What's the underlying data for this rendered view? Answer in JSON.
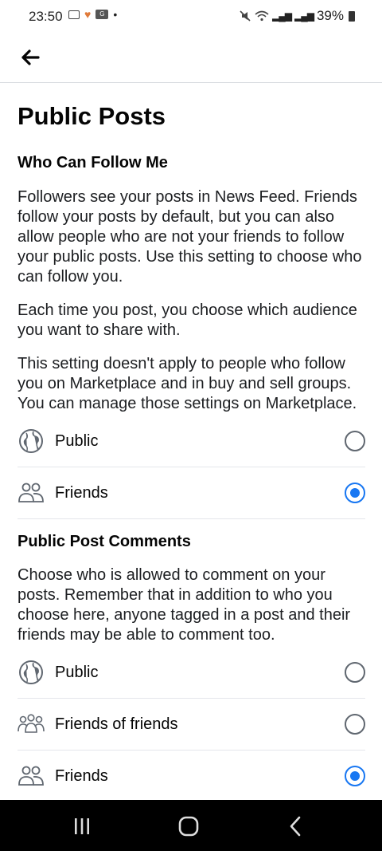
{
  "status_bar": {
    "time": "23:50",
    "battery": "39%"
  },
  "page": {
    "title": "Public Posts"
  },
  "follow_section": {
    "title": "Who Can Follow Me",
    "paragraphs": [
      "Followers see your posts in News Feed. Friends follow your posts by default, but you can also allow people who are not your friends to follow your public posts. Use this setting to choose who can follow you.",
      "Each time you post, you choose which audience you want to share with.",
      "This setting doesn't apply to people who follow you on Marketplace and in buy and sell groups. You can manage those settings on Marketplace."
    ],
    "options": [
      {
        "label": "Public",
        "icon": "globe-icon",
        "selected": false
      },
      {
        "label": "Friends",
        "icon": "friends-icon",
        "selected": true
      }
    ]
  },
  "comments_section": {
    "title": "Public Post Comments",
    "paragraph": "Choose who is allowed to comment on your posts. Remember that in addition to who you choose here, anyone tagged in a post and their friends may be able to comment too.",
    "options": [
      {
        "label": "Public",
        "icon": "globe-icon",
        "selected": false
      },
      {
        "label": "Friends of friends",
        "icon": "friends-of-friends-icon",
        "selected": false
      },
      {
        "label": "Friends",
        "icon": "friends-icon",
        "selected": true
      }
    ]
  },
  "colors": {
    "accent": "#1877f2",
    "text": "#050505",
    "divider": "#e4e6eb"
  }
}
